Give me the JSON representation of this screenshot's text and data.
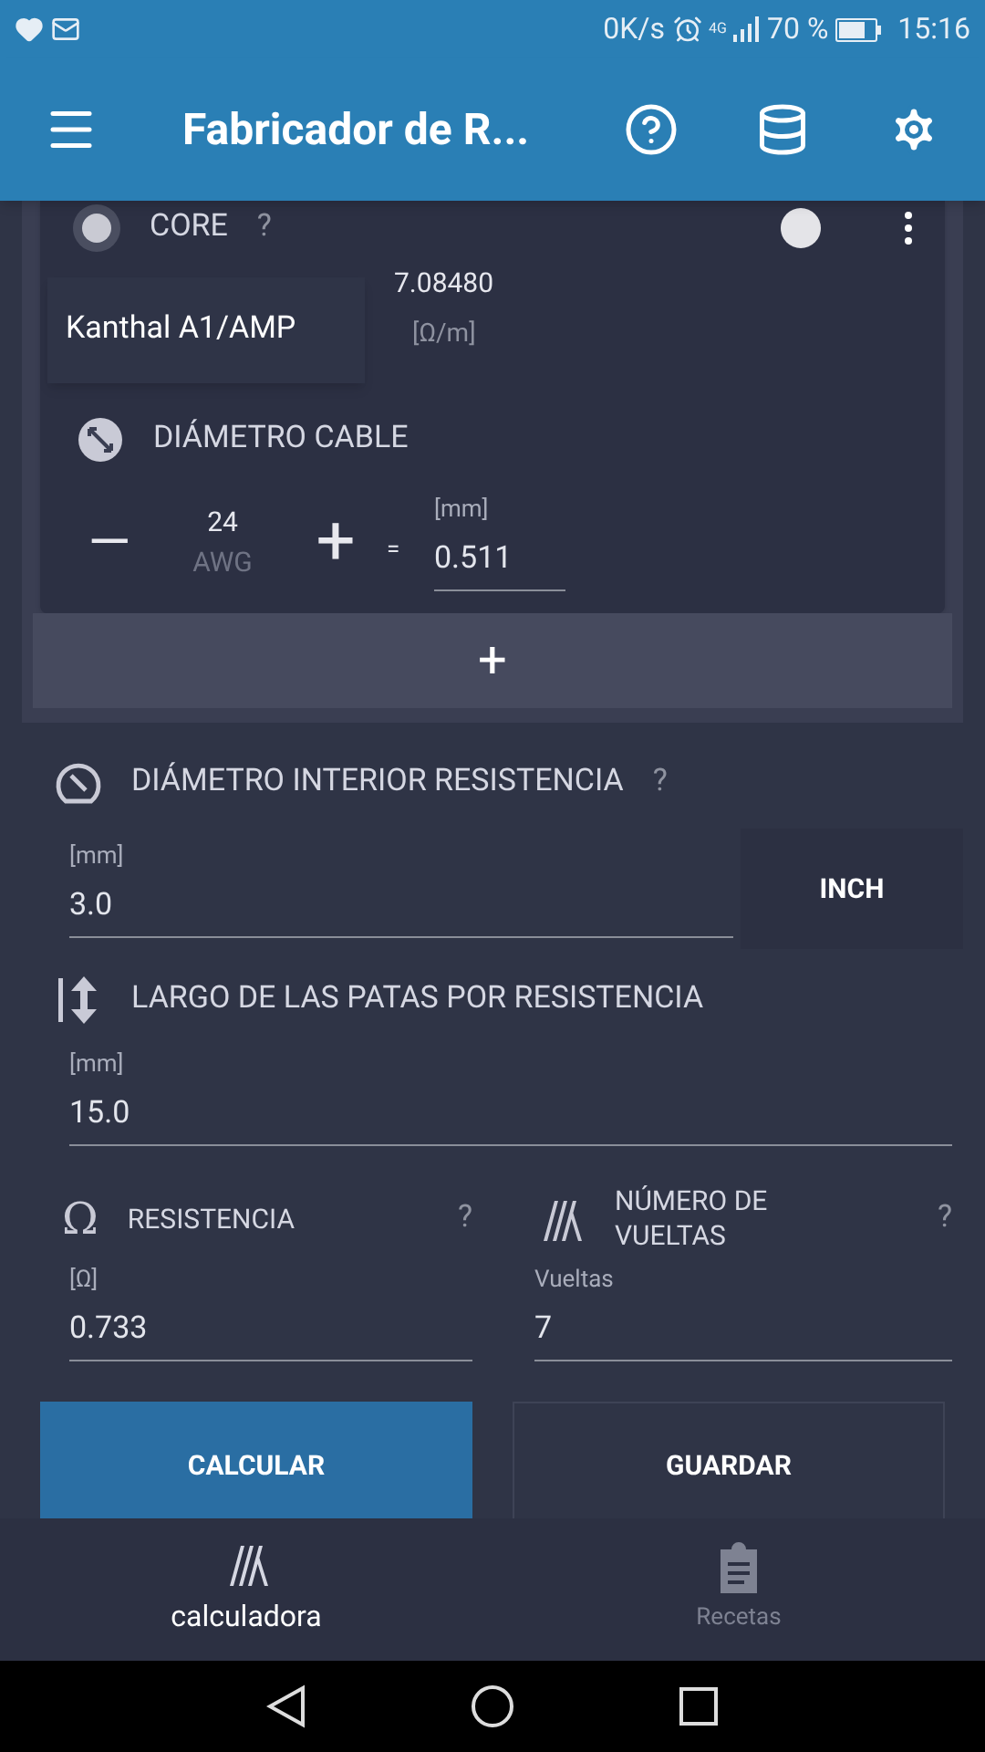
{
  "status_bar": {
    "speed": "0K/s",
    "network": "4G",
    "battery": "70 %",
    "time": "15:16"
  },
  "app_bar": {
    "title": "Fabricador de R..."
  },
  "core": {
    "label": "CORE",
    "help": "?",
    "switch_on": false,
    "material": "Kanthal A1/AMP",
    "resistivity": "7.08480",
    "resistivity_unit": "[Ω/m]"
  },
  "wire_diameter": {
    "label": "DIÁMETRO CABLE",
    "minus": "—",
    "gauge": "24",
    "gauge_unit": "AWG",
    "plus": "+",
    "equals": "=",
    "unit": "[mm]",
    "value": "0.511"
  },
  "add_button": "+",
  "inner_diameter": {
    "label": "DIÁMETRO INTERIOR RESISTENCIA",
    "help": "?",
    "unit": "[mm]",
    "value": "3.0",
    "unit_button": "INCH"
  },
  "leg_length": {
    "label": "LARGO DE LAS PATAS POR RESISTENCIA",
    "unit": "[mm]",
    "value": "15.0"
  },
  "resistance": {
    "symbol": "Ω",
    "label": "RESISTENCIA",
    "help": "?",
    "unit": "[Ω]",
    "value": "0.733"
  },
  "wraps": {
    "label": "NÚMERO DE VUELTAS",
    "help": "?",
    "unit": "Vueltas",
    "value": "7"
  },
  "buttons": [
    "CALCULAR",
    "GUARDAR"
  ],
  "bottom_nav": [
    {
      "label": "calculadora",
      "kind": "coil",
      "selected": true
    },
    {
      "label": "Recetas",
      "kind": "clipboard",
      "selected": false
    }
  ]
}
